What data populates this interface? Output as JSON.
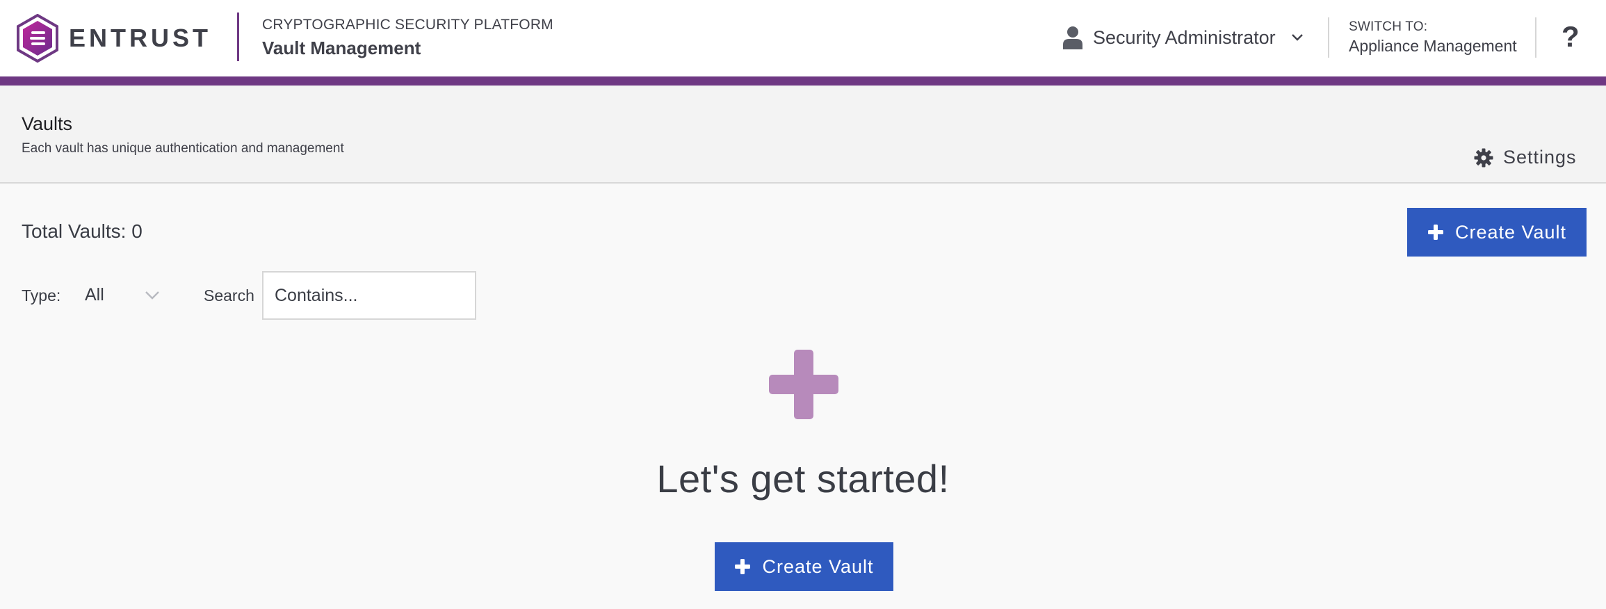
{
  "header": {
    "brand": "ENTRUST",
    "platform_subtitle": "CRYPTOGRAPHIC SECURITY PLATFORM",
    "platform_title": "Vault Management",
    "user_name": "Security Administrator",
    "switch_label": "SWITCH TO:",
    "switch_target": "Appliance Management",
    "help_label": "?"
  },
  "page": {
    "title": "Vaults",
    "subtitle": "Each vault has unique authentication and management",
    "settings_label": "Settings"
  },
  "content": {
    "total_vaults": "Total Vaults: 0",
    "create_button": "Create Vault",
    "filters": {
      "type_label": "Type:",
      "type_value": "All",
      "search_label": "Search",
      "search_placeholder": "Contains..."
    },
    "empty_state": {
      "title": "Let's get started!",
      "button": "Create Vault"
    }
  },
  "colors": {
    "accent_purple": "#6e3883",
    "primary_blue": "#2f5abf",
    "plus_lilac": "#b78abb"
  }
}
